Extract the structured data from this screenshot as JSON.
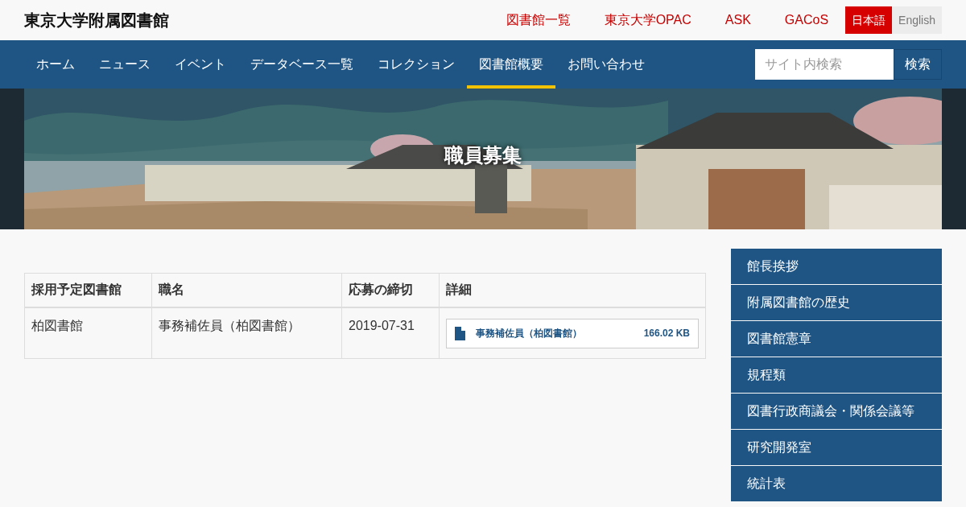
{
  "site_title": "東京大学附属図書館",
  "header_links": [
    "図書館一覧",
    "東京大学OPAC",
    "ASK",
    "GACoS"
  ],
  "languages": [
    {
      "label": "日本語",
      "selected": true
    },
    {
      "label": "English",
      "selected": false
    }
  ],
  "nav": [
    {
      "label": "ホーム",
      "selected": false
    },
    {
      "label": "ニュース",
      "selected": false
    },
    {
      "label": "イベント",
      "selected": false
    },
    {
      "label": "データベース一覧",
      "selected": false
    },
    {
      "label": "コレクション",
      "selected": false
    },
    {
      "label": "図書館概要",
      "selected": true
    },
    {
      "label": "お問い合わせ",
      "selected": false
    }
  ],
  "search": {
    "placeholder": "サイト内検索",
    "button": "検索"
  },
  "banner": {
    "kind": "picture",
    "title": "職員募集"
  },
  "table": {
    "columns": [
      "採用予定図書館",
      "職名",
      "応募の締切",
      "詳細"
    ],
    "rows": [
      {
        "library": "柏図書館",
        "position": "事務補佐員（柏図書館）",
        "deadline": "2019-07-31",
        "file": {
          "name": "事務補佐員（柏図書館）",
          "size": "166.02 KB"
        }
      }
    ]
  },
  "sidebar": {
    "items": [
      "館長挨拶",
      "附属図書館の歴史",
      "図書館憲章",
      "規程類",
      "図書行政商議会・関係会議等",
      "研究開発室",
      "統計表"
    ]
  }
}
